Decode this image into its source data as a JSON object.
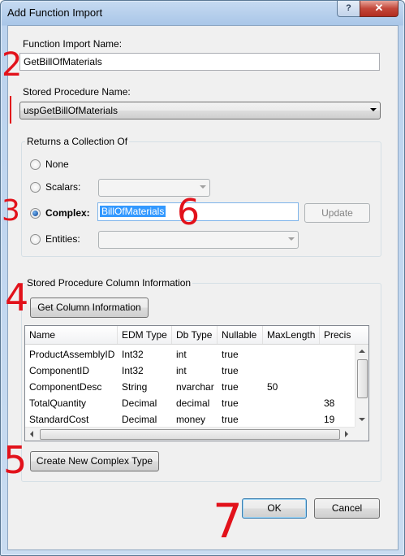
{
  "window": {
    "title": "Add Function Import",
    "help_glyph": "?",
    "close_glyph": "✕"
  },
  "function_import": {
    "label": "Function Import Name:",
    "value": "GetBillOfMaterials"
  },
  "stored_procedure": {
    "label": "Stored Procedure Name:",
    "value": "uspGetBillOfMaterials"
  },
  "returns_group": {
    "caption": "Returns a Collection Of",
    "options": [
      {
        "label": "None",
        "checked": false
      },
      {
        "label": "Scalars:",
        "checked": false
      },
      {
        "label": "Complex:",
        "checked": true
      },
      {
        "label": "Entities:",
        "checked": false
      }
    ],
    "complex_value": "BillOfMaterials",
    "update_label": "Update"
  },
  "column_group": {
    "caption": "Stored Procedure Column Information",
    "get_columns_label": "Get Column Information",
    "columns": [
      "Name",
      "EDM Type",
      "Db Type",
      "Nullable",
      "MaxLength",
      "Precis"
    ],
    "rows": [
      [
        "ProductAssemblyID",
        "Int32",
        "int",
        "true",
        "",
        ""
      ],
      [
        "ComponentID",
        "Int32",
        "int",
        "true",
        "",
        ""
      ],
      [
        "ComponentDesc",
        "String",
        "nvarchar",
        "true",
        "50",
        ""
      ],
      [
        "TotalQuantity",
        "Decimal",
        "decimal",
        "true",
        "",
        "38"
      ],
      [
        "StandardCost",
        "Decimal",
        "money",
        "true",
        "",
        "19"
      ]
    ],
    "create_label": "Create New Complex Type"
  },
  "buttons": {
    "ok": "OK",
    "cancel": "Cancel"
  },
  "annotations": [
    "2",
    "3",
    "4",
    "5",
    "6",
    "7"
  ],
  "colors": {
    "annotation": "#e2121b",
    "selection": "#3399ff"
  }
}
